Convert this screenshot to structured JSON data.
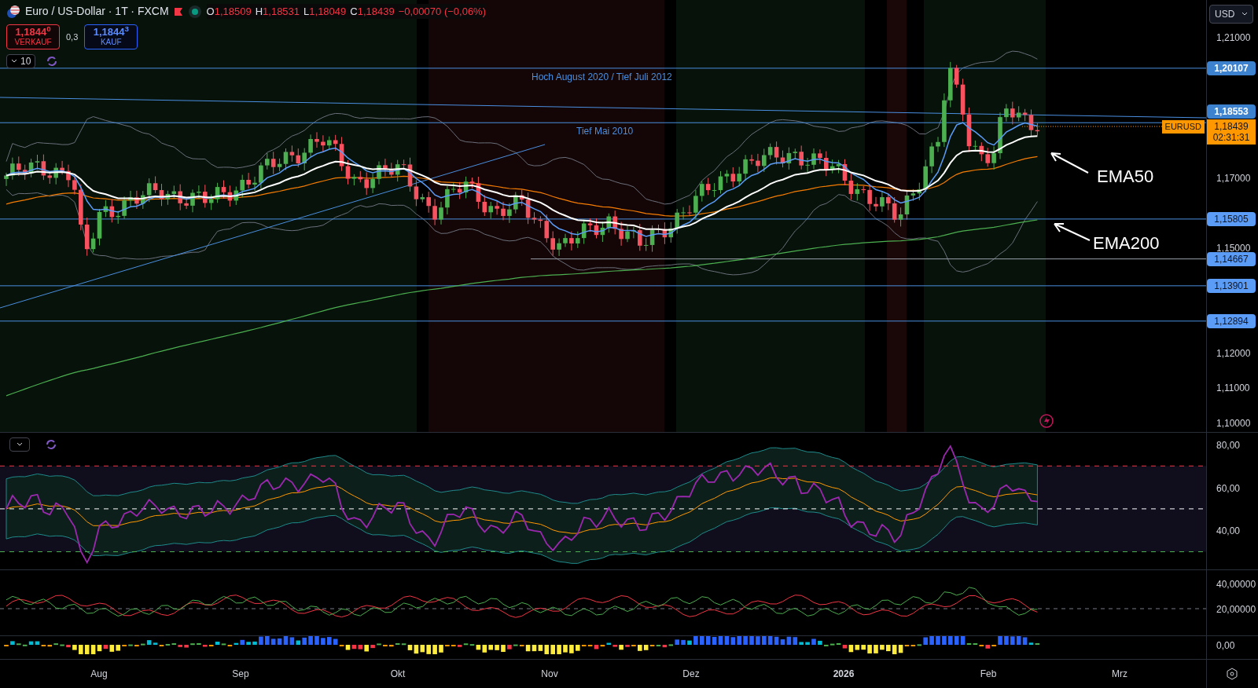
{
  "header": {
    "symbol": "Euro / US-Dollar · 1T · FXCM",
    "ohlc": [
      {
        "label": "O",
        "value": "1,18509"
      },
      {
        "label": "H",
        "value": "1,18531"
      },
      {
        "label": "L",
        "value": "1,18049"
      },
      {
        "label": "C",
        "value": "1,18439"
      }
    ],
    "change": "−0,00070 (−0,06%)"
  },
  "trade": {
    "sell": {
      "price": "1,1844$^{0}$",
      "label": "VERKAUF"
    },
    "spread": "0,3",
    "buy": {
      "price": "1,1844$^{3}$",
      "label": "KAUF"
    }
  },
  "legend_toggle": "10",
  "currency": "USD",
  "price_axis": [
    "1,21000",
    "1,17000",
    "1,15000",
    "1,12000",
    "1,11000",
    "1,10000"
  ],
  "price_levels": [
    {
      "value": "1,20107",
      "highlighted": true
    },
    {
      "value": "1,18553",
      "highlighted": true
    },
    {
      "value": "1,15805",
      "highlighted": false
    },
    {
      "value": "1,14667",
      "highlighted": false
    },
    {
      "value": "1,13901",
      "highlighted": false
    },
    {
      "value": "1,12894",
      "highlighted": false
    }
  ],
  "current_price": {
    "symbol": "EURUSD",
    "price": "1,18439",
    "countdown": "02:31:31"
  },
  "level_notes": [
    "Hoch August 2020 / Tief Juli 2012",
    "Tief Mai 2010"
  ],
  "ema_labels": [
    "EMA50",
    "EMA200"
  ],
  "rsi_axis": [
    "80,00",
    "60,00",
    "40,00"
  ],
  "adx_axis": [
    "40,00000",
    "20,00000"
  ],
  "histogram_axis": [
    "0,00"
  ],
  "time_axis": [
    "Aug",
    "Sep",
    "Okt",
    "Nov",
    "Dez",
    "2026",
    "Feb",
    "Mrz"
  ]
}
